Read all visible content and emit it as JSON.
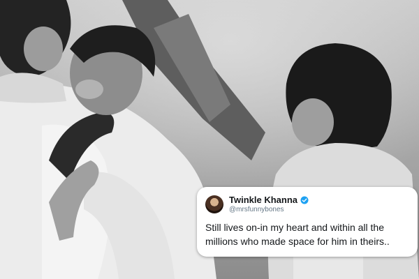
{
  "tweet": {
    "display_name": "Twinkle Khanna",
    "handle": "@mrsfunnybones",
    "text": "Still lives on-in my heart and within all the millions who made space for him in theirs..",
    "verified": true,
    "colors": {
      "card_background": "#ffffff",
      "text": "#14171a",
      "secondary_text": "#657786",
      "verified_badge": "#1da1f2"
    }
  },
  "photo": {
    "style": "black-and-white",
    "icons": [
      "vintage-family-photo"
    ]
  }
}
